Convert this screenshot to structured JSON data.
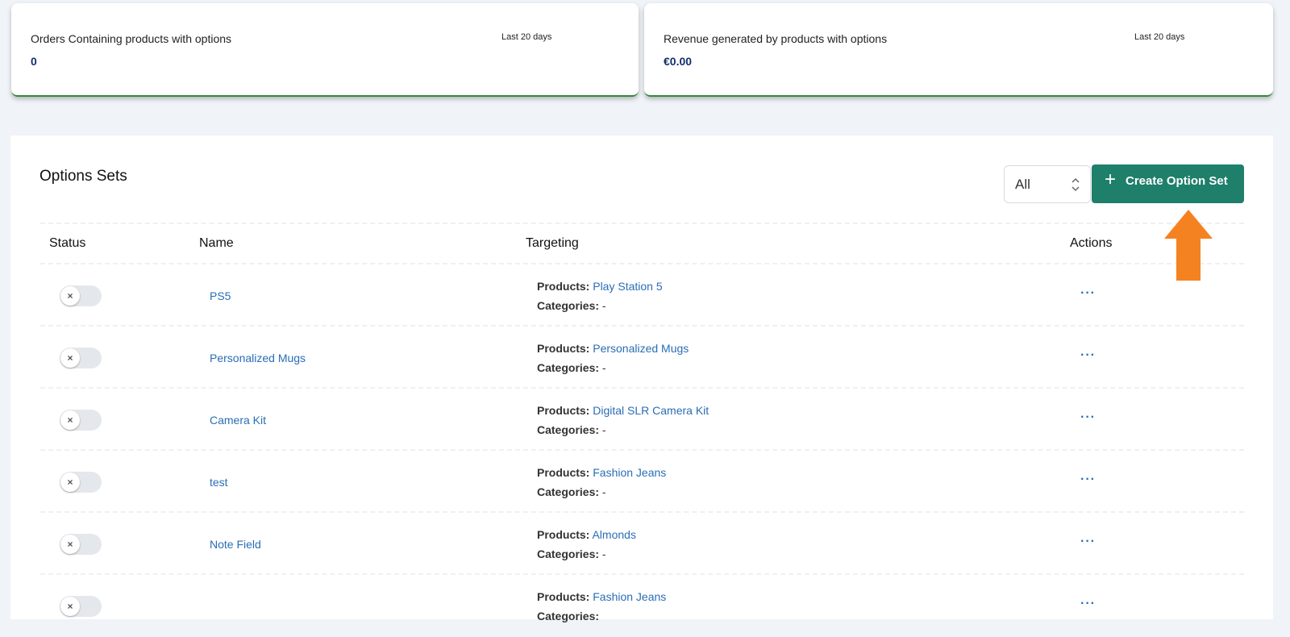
{
  "stats": [
    {
      "title": "Orders Containing products with options",
      "value": "0",
      "period": "Last 20 days"
    },
    {
      "title": "Revenue generated by products with options",
      "value": "€0.00",
      "period": "Last 20 days"
    }
  ],
  "panel": {
    "title": "Options Sets",
    "filter_value": "All",
    "create_label": "Create Option Set"
  },
  "table": {
    "headers": [
      "Status",
      "Name",
      "Targeting",
      "Actions"
    ],
    "products_label": "Products:",
    "categories_label": "Categories:",
    "rows": [
      {
        "name": "PS5",
        "products": "Play Station 5",
        "categories": "-",
        "status": "off"
      },
      {
        "name": "Personalized Mugs",
        "products": "Personalized Mugs",
        "categories": "-",
        "status": "off"
      },
      {
        "name": "Camera Kit",
        "products": "Digital SLR Camera Kit",
        "categories": "-",
        "status": "off"
      },
      {
        "name": "test",
        "products": "Fashion Jeans",
        "categories": "-",
        "status": "off"
      },
      {
        "name": "Note Field",
        "products": "Almonds",
        "categories": "-",
        "status": "off"
      },
      {
        "name": "",
        "products": "Fashion Jeans",
        "categories": "",
        "status": "off"
      }
    ],
    "actions_glyph": "···"
  },
  "colors": {
    "accent": "#1e7f6b",
    "link": "#2a6db5",
    "arrow": "#f58220",
    "card_border": "#2f8a3c"
  },
  "icons": {
    "plus": "plus-icon",
    "toggle_off": "x-icon",
    "select": "chevron-updown-icon",
    "pointer": "arrow-up-icon"
  }
}
